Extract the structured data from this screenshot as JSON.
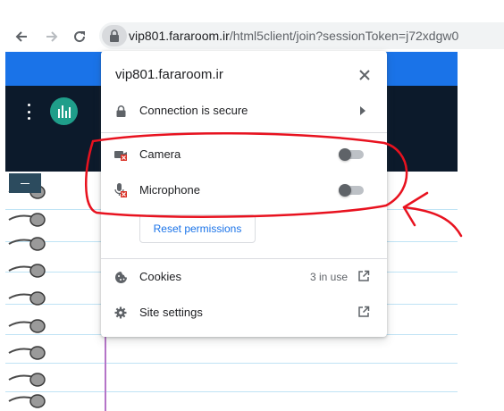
{
  "browser": {
    "url_host": "vip801.fararoom.ir",
    "url_path": "/html5client/join?sessionToken=j72xdgw0"
  },
  "site_info": {
    "title": "vip801.fararoom.ir",
    "connection_label": "Connection is secure",
    "camera_label": "Camera",
    "camera_enabled": false,
    "microphone_label": "Microphone",
    "microphone_enabled": false,
    "reset_label": "Reset permissions",
    "cookies_label": "Cookies",
    "cookies_count": "3 in use",
    "site_settings_label": "Site settings"
  },
  "icons": {
    "back": "arrow-left-icon",
    "forward": "arrow-right-icon",
    "reload": "reload-icon",
    "lock": "lock-icon",
    "close": "close-icon",
    "camera": "camera-blocked-icon",
    "microphone": "microphone-blocked-icon",
    "cookies": "cookie-icon",
    "settings": "gear-icon",
    "external": "open-external-icon"
  },
  "colors": {
    "annotation": "#e8121f",
    "brand_blue": "#1a73e8",
    "app_bar": "#0c1a2b",
    "app_logo": "#1f9e8a"
  }
}
